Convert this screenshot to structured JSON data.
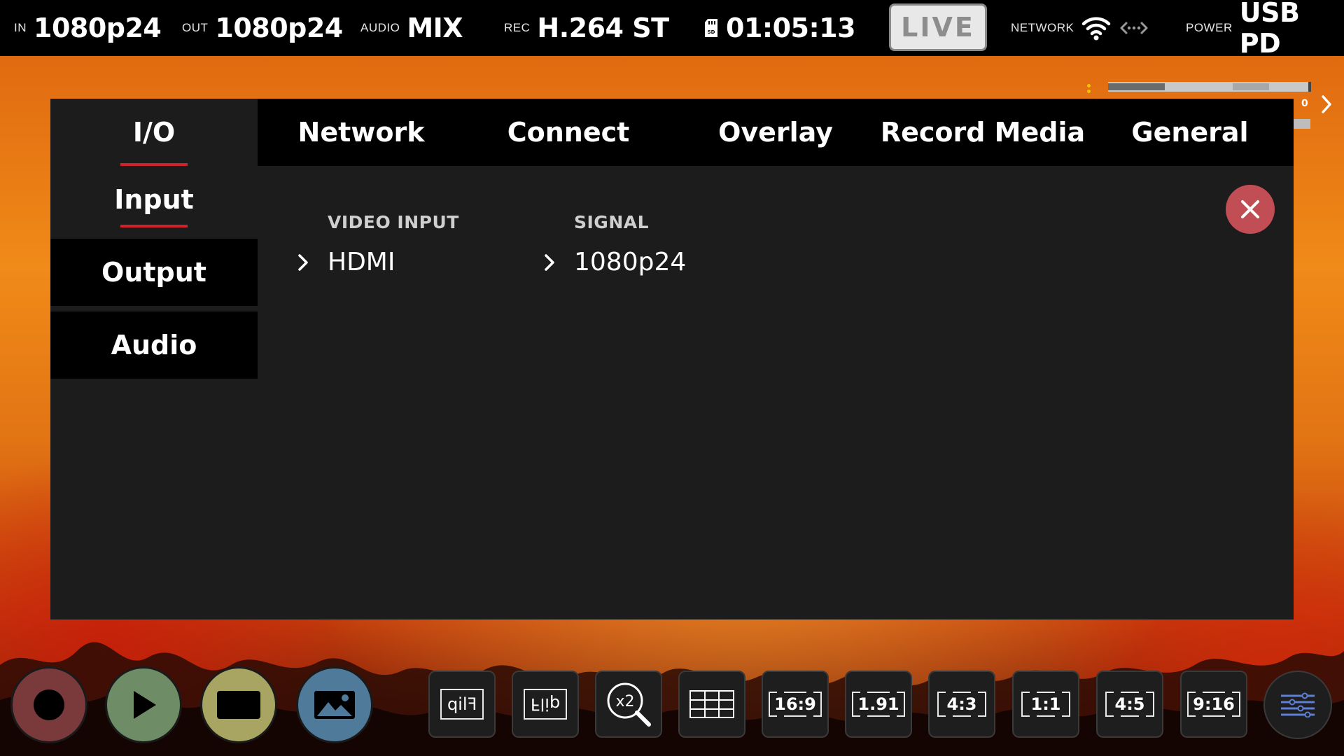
{
  "status_bar": {
    "input": {
      "label": "IN",
      "value": "1080p24"
    },
    "output": {
      "label": "OUT",
      "value": "1080p24"
    },
    "audio": {
      "label": "AUDIO",
      "value": "MIX"
    },
    "rec": {
      "label": "REC",
      "value": "H.264 ST"
    },
    "storage": {
      "icon": "sd-card-icon",
      "value": "01:05:13"
    },
    "live_label": "LIVE",
    "network": {
      "label": "NETWORK",
      "icons": [
        "wifi-icon",
        "ethernet-icon"
      ]
    },
    "power": {
      "label": "POWER",
      "value": "USB PD"
    }
  },
  "audio_meter": {
    "level": 0.45,
    "peak_label": "0"
  },
  "tabs": [
    {
      "label": "I/O",
      "active": true
    },
    {
      "label": "Network",
      "active": false
    },
    {
      "label": "Connect",
      "active": false
    },
    {
      "label": "Overlay",
      "active": false
    },
    {
      "label": "Record Media",
      "active": false
    },
    {
      "label": "General",
      "active": false
    }
  ],
  "side_nav": [
    {
      "label": "Input",
      "active": true
    },
    {
      "label": "Output",
      "active": false
    },
    {
      "label": "Audio",
      "active": false
    }
  ],
  "input_settings": {
    "video_input": {
      "label": "VIDEO INPUT",
      "value": "HDMI"
    },
    "signal": {
      "label": "SIGNAL",
      "value": "1080p24"
    }
  },
  "bottom_bar": {
    "circle_buttons": [
      {
        "name": "record-button",
        "icon": "record-icon",
        "color": "#7a3a3c"
      },
      {
        "name": "play-button",
        "icon": "play-icon",
        "color": "#6e8d66"
      },
      {
        "name": "monitor-button",
        "icon": "screen-icon",
        "color": "#a8a462"
      },
      {
        "name": "gallery-button",
        "icon": "image-icon",
        "color": "#4f7a9a"
      }
    ],
    "flip_horizontal_label": "Flip",
    "flip_vertical_label": "Flip",
    "zoom_label": "x2",
    "ratios": [
      "16:9",
      "1.91",
      "4:3",
      "1:1",
      "4:5",
      "9:16"
    ]
  },
  "colors": {
    "accent_red": "#d0222a",
    "close_button": "#c24e55",
    "panel_bg": "#1c1c1c"
  }
}
